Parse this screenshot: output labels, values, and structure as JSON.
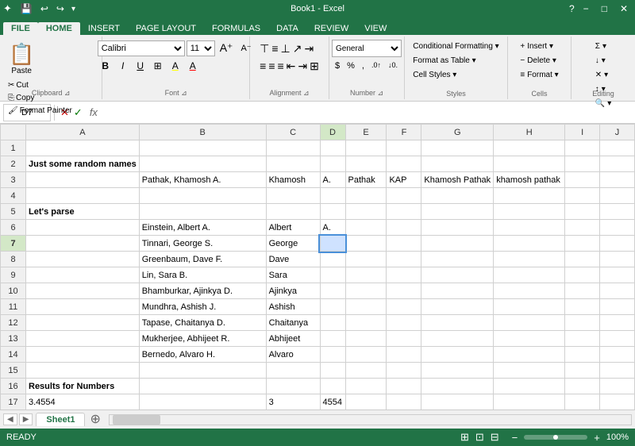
{
  "titleBar": {
    "title": "Book1 - Excel",
    "helpIcon": "?",
    "minimizeIcon": "−",
    "maximizeIcon": "□",
    "closeIcon": "✕"
  },
  "quickAccess": {
    "saveLabel": "💾",
    "undoLabel": "↩",
    "redoLabel": "↪",
    "customizeLabel": "▾"
  },
  "ribbonTabs": [
    "FILE",
    "HOME",
    "INSERT",
    "PAGE LAYOUT",
    "FORMULAS",
    "DATA",
    "REVIEW",
    "VIEW"
  ],
  "activeTab": "HOME",
  "ribbon": {
    "clipboard": {
      "label": "Clipboard",
      "paste": "Paste",
      "cut": "✂ Cut",
      "copy": "⎘ Copy",
      "formatPainter": "🖌 Format Painter"
    },
    "font": {
      "label": "Font",
      "fontName": "Calibri",
      "fontSize": "11",
      "bold": "B",
      "italic": "I",
      "underline": "U",
      "border": "⊞",
      "fillColor": "A",
      "fontColor": "A"
    },
    "alignment": {
      "label": "Alignment",
      "topAlign": "⊤",
      "middleAlign": "≡",
      "bottomAlign": "⊥",
      "leftAlign": "≡",
      "centerAlign": "≡",
      "rightAlign": "≡",
      "wrapText": "⇥",
      "merge": "⊞"
    },
    "number": {
      "label": "Number",
      "format": "General",
      "percent": "%",
      "comma": ",",
      "currency": "$",
      "increaseDecimal": ".0→",
      "decreaseDecimal": "←.0"
    },
    "styles": {
      "label": "Styles",
      "conditionalFormatting": "Conditional Formatting ▾",
      "formatAsTable": "Format as Table ▾",
      "cellStyles": "Cell Styles ▾"
    },
    "cells": {
      "label": "Cells",
      "insert": "Insert ▾",
      "delete": "Delete ▾",
      "format": "Format ▾"
    },
    "editing": {
      "label": "Editing",
      "sum": "Σ ▾",
      "fill": "↓ ▾",
      "clear": "✕ ▾",
      "sort": "↕ ▾",
      "find": "🔍 ▾"
    }
  },
  "formulaBar": {
    "cellRef": "D7",
    "cancelBtn": "✕",
    "confirmBtn": "✓",
    "fxLabel": "fx",
    "formula": ""
  },
  "columns": [
    "A",
    "B",
    "C",
    "D",
    "E",
    "F",
    "G",
    "H",
    "I",
    "J"
  ],
  "rows": [
    {
      "num": 1,
      "cells": [
        "",
        "",
        "",
        "",
        "",
        "",
        "",
        "",
        "",
        ""
      ]
    },
    {
      "num": 2,
      "cells": [
        "Just some random names",
        "",
        "",
        "",
        "",
        "",
        "",
        "",
        "",
        ""
      ]
    },
    {
      "num": 3,
      "cells": [
        "",
        "Pathak, Khamosh A.",
        "Khamosh",
        "A.",
        "Pathak",
        "KAP",
        "Khamosh Pathak",
        "khamosh pathak",
        "",
        ""
      ]
    },
    {
      "num": 4,
      "cells": [
        "",
        "",
        "",
        "",
        "",
        "",
        "",
        "",
        "",
        ""
      ]
    },
    {
      "num": 5,
      "cells": [
        "Let's parse",
        "",
        "",
        "",
        "",
        "",
        "",
        "",
        "",
        ""
      ]
    },
    {
      "num": 6,
      "cells": [
        "",
        "Einstein, Albert A.",
        "Albert",
        "A.",
        "",
        "",
        "",
        "",
        "",
        ""
      ]
    },
    {
      "num": 7,
      "cells": [
        "",
        "Tinnari, George S.",
        "George",
        "",
        "",
        "",
        "",
        "",
        "",
        ""
      ]
    },
    {
      "num": 8,
      "cells": [
        "",
        "Greenbaum, Dave F.",
        "Dave",
        "",
        "",
        "",
        "",
        "",
        "",
        ""
      ]
    },
    {
      "num": 9,
      "cells": [
        "",
        "Lin, Sara B.",
        "Sara",
        "",
        "",
        "",
        "",
        "",
        "",
        ""
      ]
    },
    {
      "num": 10,
      "cells": [
        "",
        "Bhamburkar, Ajinkya D.",
        "Ajinkya",
        "",
        "",
        "",
        "",
        "",
        "",
        ""
      ]
    },
    {
      "num": 11,
      "cells": [
        "",
        "Mundhra, Ashish J.",
        "Ashish",
        "",
        "",
        "",
        "",
        "",
        "",
        ""
      ]
    },
    {
      "num": 12,
      "cells": [
        "",
        "Tapase, Chaitanya D.",
        "Chaitanya",
        "",
        "",
        "",
        "",
        "",
        "",
        ""
      ]
    },
    {
      "num": 13,
      "cells": [
        "",
        "Mukherjee, Abhijeet R.",
        "Abhijeet",
        "",
        "",
        "",
        "",
        "",
        "",
        ""
      ]
    },
    {
      "num": 14,
      "cells": [
        "",
        "Bernedo, Alvaro H.",
        "Alvaro",
        "",
        "",
        "",
        "",
        "",
        "",
        ""
      ]
    },
    {
      "num": 15,
      "cells": [
        "",
        "",
        "",
        "",
        "",
        "",
        "",
        "",
        "",
        ""
      ]
    },
    {
      "num": 16,
      "cells": [
        "Results for Numbers",
        "",
        "",
        "",
        "",
        "",
        "",
        "",
        "",
        ""
      ]
    },
    {
      "num": 17,
      "cells": [
        "3.4554",
        "",
        "3",
        "4554",
        "",
        "",
        "",
        "",
        "",
        ""
      ]
    }
  ],
  "selectedCell": {
    "row": 7,
    "col": 3
  },
  "sheetTabs": [
    "Sheet1"
  ],
  "statusBar": {
    "ready": "READY",
    "sheetViewIcon": "⊞",
    "pageLayoutIcon": "⊡",
    "pageBreakIcon": "⊟",
    "zoomOut": "−",
    "zoomIn": "+",
    "zoomLevel": "100%"
  }
}
